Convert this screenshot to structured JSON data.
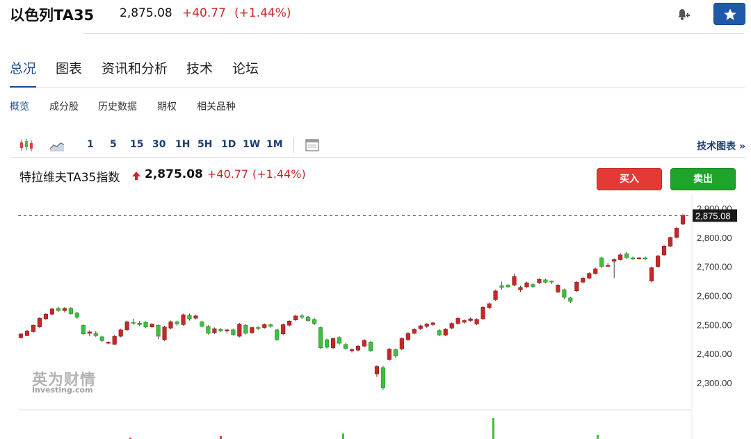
{
  "header": {
    "title": "以色列TA35",
    "price": "2,875.08",
    "change": "+40.77",
    "change_pct": "(+1.44%)"
  },
  "tabs": [
    {
      "label": "总况"
    },
    {
      "label": "图表"
    },
    {
      "label": "资讯和分析"
    },
    {
      "label": "技术"
    },
    {
      "label": "论坛"
    }
  ],
  "subtabs": [
    {
      "label": "概览"
    },
    {
      "label": "成分股"
    },
    {
      "label": "历史数据"
    },
    {
      "label": "期权"
    },
    {
      "label": "相关品种"
    }
  ],
  "toolbar": {
    "intervals": [
      "1",
      "5",
      "15",
      "30",
      "1H",
      "5H",
      "1D",
      "1W",
      "1M"
    ],
    "tech_chart_link": "技术图表 »"
  },
  "instrument": {
    "name": "特拉维夫TA35指数",
    "price": "2,875.08",
    "change": "+40.77",
    "change_pct": "(+1.44%)",
    "buy_label": "买入",
    "sell_label": "卖出"
  },
  "watermark": {
    "cn": "英为财情",
    "en": "Investing.com"
  },
  "colors": {
    "up": "#c62828",
    "down": "#3fbf3f",
    "accent": "#1e4f8f",
    "buy": "#e53935",
    "sell": "#1fa32a"
  },
  "chart_data": {
    "type": "candlestick",
    "ylim": [
      2250,
      2900
    ],
    "y_ticks": [
      "2,900.00",
      "2,800.00",
      "2,700.00",
      "2,600.00",
      "2,500.00",
      "2,400.00",
      "2,300.00"
    ],
    "y_tick_values": [
      2900,
      2800,
      2700,
      2600,
      2500,
      2400,
      2300
    ],
    "last_price": 2875.08,
    "last_price_label": "2,875.08",
    "candles": [
      [
        2455,
        2468,
        2452,
        2470
      ],
      [
        2462,
        2478,
        2460,
        2482
      ],
      [
        2476,
        2498,
        2472,
        2502
      ],
      [
        2492,
        2522,
        2488,
        2526
      ],
      [
        2520,
        2536,
        2516,
        2540
      ],
      [
        2536,
        2554,
        2532,
        2558
      ],
      [
        2556,
        2548,
        2544,
        2562
      ],
      [
        2548,
        2556,
        2542,
        2560
      ],
      [
        2556,
        2538,
        2534,
        2560
      ],
      [
        2540,
        2525,
        2520,
        2544
      ],
      [
        2498,
        2468,
        2464,
        2500
      ],
      [
        2470,
        2475,
        2460,
        2480
      ],
      [
        2470,
        2462,
        2458,
        2478
      ],
      [
        2458,
        2445,
        2440,
        2462
      ],
      [
        2436,
        2440,
        2432,
        2442
      ],
      [
        2432,
        2460,
        2430,
        2464
      ],
      [
        2460,
        2482,
        2456,
        2486
      ],
      [
        2482,
        2510,
        2478,
        2514
      ],
      [
        2508,
        2505,
        2500,
        2520
      ],
      [
        2505,
        2500,
        2496,
        2512
      ],
      [
        2508,
        2492,
        2488,
        2512
      ],
      [
        2492,
        2502,
        2488,
        2506
      ],
      [
        2498,
        2460,
        2450,
        2500
      ],
      [
        2448,
        2492,
        2444,
        2496
      ],
      [
        2488,
        2510,
        2484,
        2514
      ],
      [
        2510,
        2502,
        2496,
        2514
      ],
      [
        2500,
        2534,
        2496,
        2538
      ],
      [
        2532,
        2520,
        2514,
        2538
      ],
      [
        2522,
        2530,
        2518,
        2534
      ],
      [
        2510,
        2494,
        2490,
        2514
      ],
      [
        2494,
        2470,
        2466,
        2498
      ],
      [
        2472,
        2486,
        2468,
        2490
      ],
      [
        2484,
        2478,
        2474,
        2488
      ],
      [
        2478,
        2482,
        2470,
        2486
      ],
      [
        2482,
        2466,
        2462,
        2486
      ],
      [
        2460,
        2502,
        2456,
        2506
      ],
      [
        2498,
        2470,
        2466,
        2502
      ],
      [
        2472,
        2490,
        2468,
        2494
      ],
      [
        2490,
        2488,
        2482,
        2494
      ],
      [
        2490,
        2500,
        2486,
        2504
      ],
      [
        2500,
        2494,
        2490,
        2504
      ],
      [
        2482,
        2448,
        2444,
        2486
      ],
      [
        2468,
        2500,
        2464,
        2504
      ],
      [
        2498,
        2512,
        2494,
        2516
      ],
      [
        2516,
        2530,
        2512,
        2534
      ],
      [
        2530,
        2526,
        2520,
        2536
      ],
      [
        2526,
        2514,
        2510,
        2530
      ],
      [
        2518,
        2504,
        2498,
        2522
      ],
      [
        2490,
        2420,
        2416,
        2494
      ],
      [
        2448,
        2422,
        2418,
        2452
      ],
      [
        2420,
        2452,
        2416,
        2456
      ],
      [
        2456,
        2436,
        2430,
        2460
      ],
      [
        2432,
        2418,
        2414,
        2436
      ],
      [
        2410,
        2414,
        2404,
        2418
      ],
      [
        2412,
        2426,
        2408,
        2430
      ],
      [
        2426,
        2446,
        2422,
        2450
      ],
      [
        2440,
        2410,
        2406,
        2444
      ],
      [
        2330,
        2356,
        2320,
        2360
      ],
      [
        2352,
        2282,
        2276,
        2358
      ],
      [
        2380,
        2416,
        2376,
        2420
      ],
      [
        2414,
        2392,
        2386,
        2418
      ],
      [
        2416,
        2452,
        2412,
        2456
      ],
      [
        2448,
        2470,
        2444,
        2474
      ],
      [
        2470,
        2484,
        2466,
        2488
      ],
      [
        2486,
        2496,
        2482,
        2500
      ],
      [
        2494,
        2502,
        2488,
        2506
      ],
      [
        2500,
        2506,
        2496,
        2510
      ],
      [
        2480,
        2464,
        2460,
        2484
      ],
      [
        2464,
        2484,
        2460,
        2488
      ],
      [
        2488,
        2504,
        2484,
        2508
      ],
      [
        2504,
        2522,
        2500,
        2526
      ],
      [
        2508,
        2514,
        2504,
        2518
      ],
      [
        2514,
        2520,
        2510,
        2524
      ],
      [
        2502,
        2518,
        2498,
        2522
      ],
      [
        2520,
        2560,
        2516,
        2564
      ],
      [
        2558,
        2572,
        2554,
        2576
      ],
      [
        2586,
        2616,
        2582,
        2620
      ],
      [
        2634,
        2628,
        2620,
        2648
      ],
      [
        2636,
        2630,
        2626,
        2640
      ],
      [
        2636,
        2666,
        2632,
        2676
      ],
      [
        2620,
        2628,
        2612,
        2634
      ],
      [
        2630,
        2644,
        2626,
        2648
      ],
      [
        2638,
        2630,
        2626,
        2644
      ],
      [
        2644,
        2656,
        2640,
        2660
      ],
      [
        2654,
        2646,
        2642,
        2658
      ],
      [
        2650,
        2648,
        2640,
        2652
      ],
      [
        2612,
        2636,
        2608,
        2640
      ],
      [
        2620,
        2594,
        2588,
        2624
      ],
      [
        2592,
        2580,
        2574,
        2596
      ],
      [
        2616,
        2646,
        2612,
        2650
      ],
      [
        2646,
        2660,
        2642,
        2664
      ],
      [
        2660,
        2676,
        2656,
        2680
      ],
      [
        2676,
        2692,
        2672,
        2696
      ],
      [
        2730,
        2700,
        2696,
        2734
      ],
      [
        2702,
        2704,
        2698,
        2712
      ],
      [
        2718,
        2724,
        2660,
        2728
      ],
      [
        2724,
        2740,
        2720,
        2746
      ],
      [
        2744,
        2730,
        2726,
        2750
      ],
      [
        2730,
        2728,
        2722,
        2734
      ],
      [
        2728,
        2730,
        2724,
        2732
      ],
      [
        2730,
        2728,
        2722,
        2734
      ],
      [
        2650,
        2696,
        2646,
        2700
      ],
      [
        2700,
        2736,
        2696,
        2740
      ],
      [
        2740,
        2770,
        2736,
        2774
      ],
      [
        2770,
        2800,
        2766,
        2804
      ],
      [
        2800,
        2832,
        2796,
        2836
      ],
      [
        2846,
        2876,
        2842,
        2880
      ]
    ]
  }
}
